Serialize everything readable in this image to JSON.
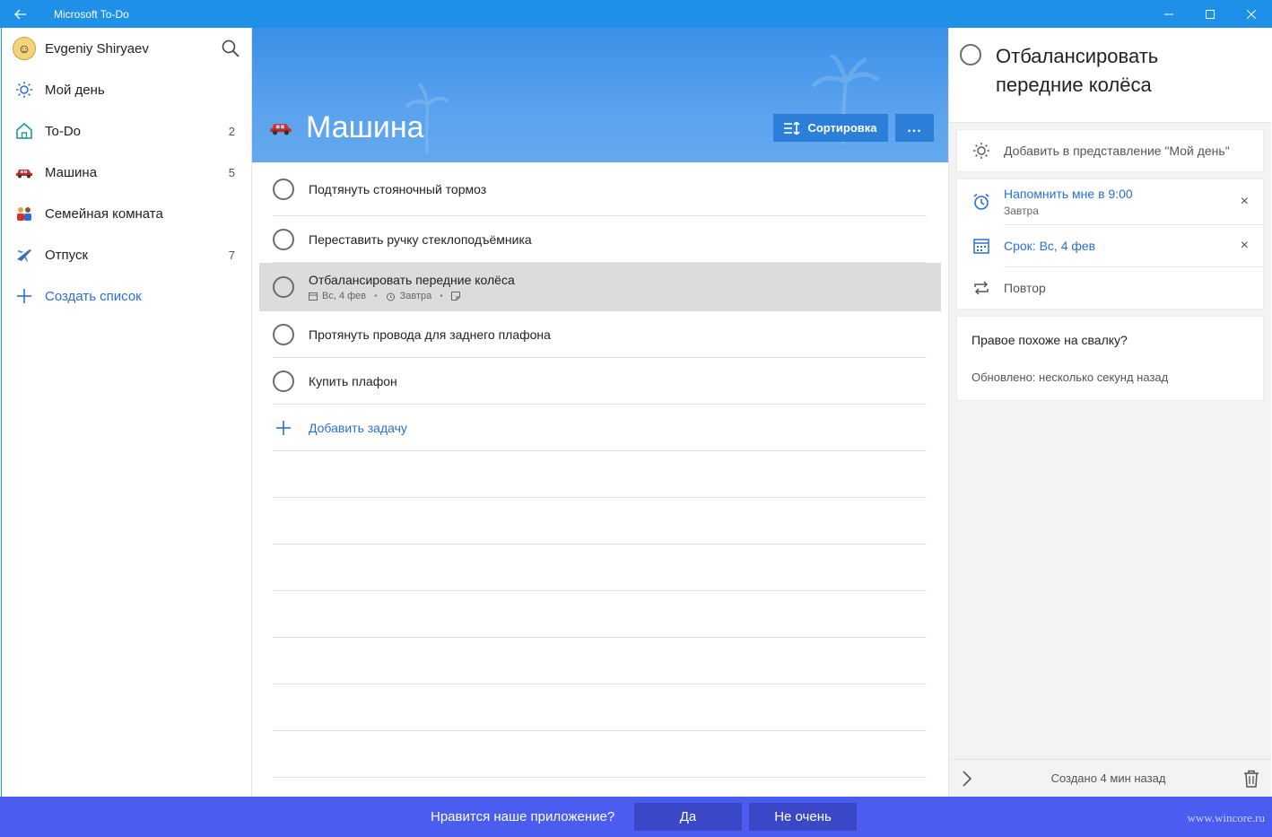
{
  "window": {
    "title": "Microsoft To-Do"
  },
  "sidebar": {
    "user_name": "Evgeniy Shiryaev",
    "items": [
      {
        "label": "Мой день",
        "count": "",
        "icon": "sun-icon"
      },
      {
        "label": "To-Do",
        "count": "2",
        "icon": "home-icon"
      },
      {
        "label": "Машина",
        "count": "5",
        "icon": "car-icon"
      },
      {
        "label": "Семейная комната",
        "count": "",
        "icon": "family-icon"
      },
      {
        "label": "Отпуск",
        "count": "7",
        "icon": "airplane-icon"
      }
    ],
    "create_label": "Создать список"
  },
  "list": {
    "title": "Машина",
    "sort_label": "Сортировка",
    "more_label": "...",
    "tasks": [
      {
        "title": "Подтянуть стояночный тормоз"
      },
      {
        "title": "Переставить ручку стеклоподъёмника"
      },
      {
        "title": "Отбалансировать передние колёса",
        "due": "Вс, 4 фев",
        "reminder": "Завтра"
      },
      {
        "title": "Протянуть провода для заднего плафона"
      },
      {
        "title": "Купить плафон"
      }
    ],
    "add_task_label": "Добавить задачу"
  },
  "detail": {
    "title": "Отбалансировать передние колёса",
    "my_day_label": "Добавить в представление \"Мой день\"",
    "reminder_label": "Напомнить мне в 9:00",
    "reminder_sub": "Завтра",
    "due_label": "Срок: Вс, 4 фев",
    "repeat_label": "Повтор",
    "note": "Правое похоже на свалку?",
    "updated": "Обновлено: несколько секунд назад",
    "created": "Создано 4 мин назад",
    "close_symbol": "×"
  },
  "feedback": {
    "question": "Нравится наше приложение?",
    "yes_label": "Да",
    "no_label": "Не очень",
    "watermark": "www.wincore.ru"
  },
  "colors": {
    "titlebar": "#1e90e8",
    "accent": "#2a6fd6",
    "banner": "#4a9bec",
    "feedback_bar": "#4a5df0"
  }
}
